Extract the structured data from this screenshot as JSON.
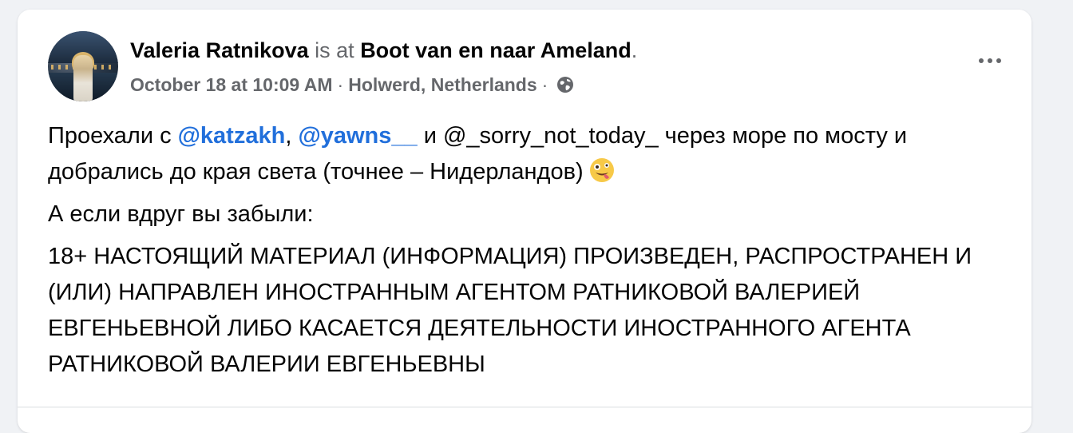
{
  "post": {
    "author": "Valeria Ratnikova",
    "is_at": "is at",
    "place": "Boot van en naar Ameland",
    "period": ".",
    "date": "October 18 at 10:09 AM",
    "dot": "·",
    "location": "Holwerd, Netherlands",
    "privacy_icon": "globe-icon",
    "more_icon": "more-options-icon",
    "paragraph1": {
      "t1": "Проехали с ",
      "m1": "@katzakh",
      "t2": ", ",
      "m2": "@yawns__",
      "t3": " и @_sorry_not_today_ через море по мосту и добрались до края света (точнее – Нидерландов)",
      "emoji": "zany-face-emoji"
    },
    "paragraph2": "А если вдруг вы забыли:",
    "paragraph3": "18+ НАСТОЯЩИЙ МАТЕРИАЛ (ИНФОРМАЦИЯ) ПРОИЗВЕДЕН, РАСПРОСТРАНЕН И (ИЛИ) НАПРАВЛЕН ИНОСТРАННЫМ АГЕНТОМ РАТНИКОВОЙ ВАЛЕРИЕЙ ЕВГЕНЬЕВНОЙ ЛИБО КАСАЕТСЯ ДЕЯТЕЛЬНОСТИ ИНОСТРАННОГО АГЕНТА РАТНИКОВОЙ ВАЛЕРИИ ЕВГЕНЬЕВНЫ"
  },
  "colors": {
    "link": "#216fdb",
    "muted": "#65676b",
    "background": "#f0f2f5",
    "card": "#ffffff"
  }
}
